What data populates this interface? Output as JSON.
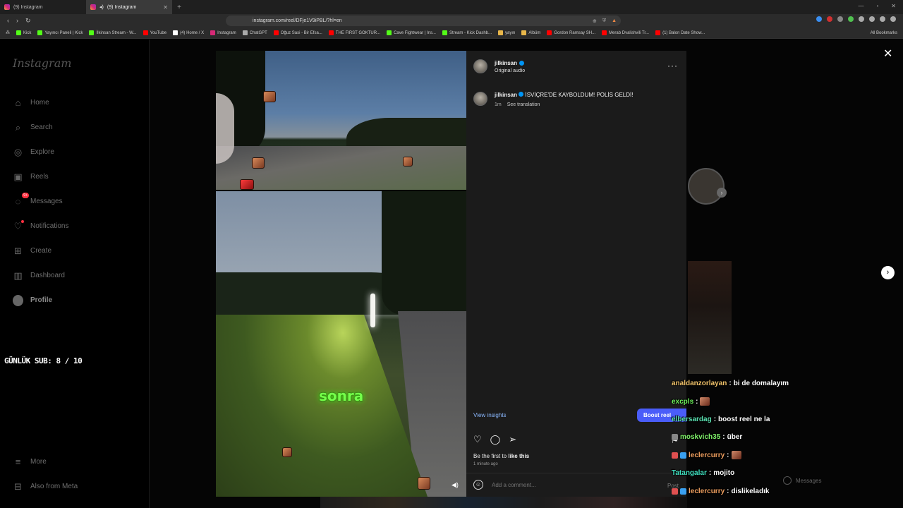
{
  "browser": {
    "tabs": [
      {
        "title": "(9) Instagram",
        "active": false
      },
      {
        "title": "(9) Instagram",
        "active": true
      }
    ],
    "url": "instagram.com/reel/DFje1V9iPBL/?hl=en",
    "bookmarks": [
      {
        "label": "Kick",
        "color": "#53fc18"
      },
      {
        "label": "Yayıncı Paneli | Kick",
        "color": "#53fc18"
      },
      {
        "label": "İlkinsan Stream - W...",
        "color": "#53fc18"
      },
      {
        "label": "YouTube",
        "color": "#ff0000"
      },
      {
        "label": "(4) Home / X",
        "color": "#ffffff"
      },
      {
        "label": "Instagram",
        "color": "#d62976"
      },
      {
        "label": "ChatGPT",
        "color": "#aaaaaa"
      },
      {
        "label": "Oğuz Sasi - Bir Efsa...",
        "color": "#ff0000"
      },
      {
        "label": "THE FIRST GOKTUR...",
        "color": "#ff0000"
      },
      {
        "label": "Cave Fightwear | Ins...",
        "color": "#53fc18"
      },
      {
        "label": "Stream - Kick Dashb...",
        "color": "#53fc18"
      },
      {
        "label": "yayın",
        "color": "#e8b64a"
      },
      {
        "label": "Albüm",
        "color": "#e8b64a"
      },
      {
        "label": "Gordon Ramsay SH...",
        "color": "#ff0000"
      },
      {
        "label": "Merab Dvalishvili Tr...",
        "color": "#ff0000"
      },
      {
        "label": "(1) Balon Date Show...",
        "color": "#ff0000"
      }
    ],
    "all_bookmarks": "All Bookmarks"
  },
  "sidebar": {
    "logo": "Instagram",
    "items": [
      {
        "label": "Home",
        "icon": "⌂"
      },
      {
        "label": "Search",
        "icon": "⌕"
      },
      {
        "label": "Explore",
        "icon": "◎"
      },
      {
        "label": "Reels",
        "icon": "▣"
      },
      {
        "label": "Messages",
        "icon": "◌",
        "badge": "9+"
      },
      {
        "label": "Notifications",
        "icon": "♡"
      },
      {
        "label": "Create",
        "icon": "⊞"
      },
      {
        "label": "Dashboard",
        "icon": "▥"
      },
      {
        "label": "Profile",
        "icon": ""
      }
    ],
    "bottom": [
      {
        "label": "More",
        "icon": "≡"
      },
      {
        "label": "Also from Meta",
        "icon": "⊟"
      }
    ]
  },
  "reel": {
    "username": "jilkinsan",
    "audio": "Original audio",
    "caption": "İSVİÇRE'DE KAYBOLDUM! POLİS GELDİ!",
    "time": "1m",
    "see_translation": "See translation",
    "overlay_text": "sonra",
    "view_insights": "View insights",
    "boost_label": "Boost reel",
    "likes_prefix": "Be the first to",
    "likes_action": "like this",
    "posted_ago": "1 minute ago",
    "comment_placeholder": "Add a comment...",
    "post_label": "Post"
  },
  "stream": {
    "counter": "GÜNLÜK SUB: 8 / 10",
    "chat": [
      {
        "user": "analdanzorlayan",
        "color": "#f0c26a",
        "text": "bi de domalayım",
        "emote": false,
        "badges": []
      },
      {
        "user": "excpls",
        "color": "#6cf05a",
        "text": "",
        "emote": true,
        "badges": []
      },
      {
        "user": "elbersardag",
        "color": "#5ae0b0",
        "text": "boost reel ne la",
        "emote": false,
        "badges": []
      },
      {
        "user": "moskvich35",
        "color": "#7ff06a",
        "text": "über",
        "emote": false,
        "badges": [
          "#888888"
        ]
      },
      {
        "user": "leclercurry",
        "color": "#f0a060",
        "text": "",
        "emote": true,
        "badges": [
          "#e05050",
          "#3aa0f0"
        ]
      },
      {
        "user": "Tatangalar",
        "color": "#40e0c0",
        "text": "mojito",
        "emote": false,
        "badges": []
      },
      {
        "user": "leclercurry",
        "color": "#f0a060",
        "text": "dislikeladık",
        "emote": false,
        "badges": [
          "#e05050",
          "#3aa0f0"
        ]
      }
    ],
    "ghost_messages": "Messages"
  },
  "colors": {
    "accent": "#4a5df9",
    "link": "#8bb8ff",
    "verified": "#0095f6",
    "overlay_green": "#74ff4a"
  }
}
